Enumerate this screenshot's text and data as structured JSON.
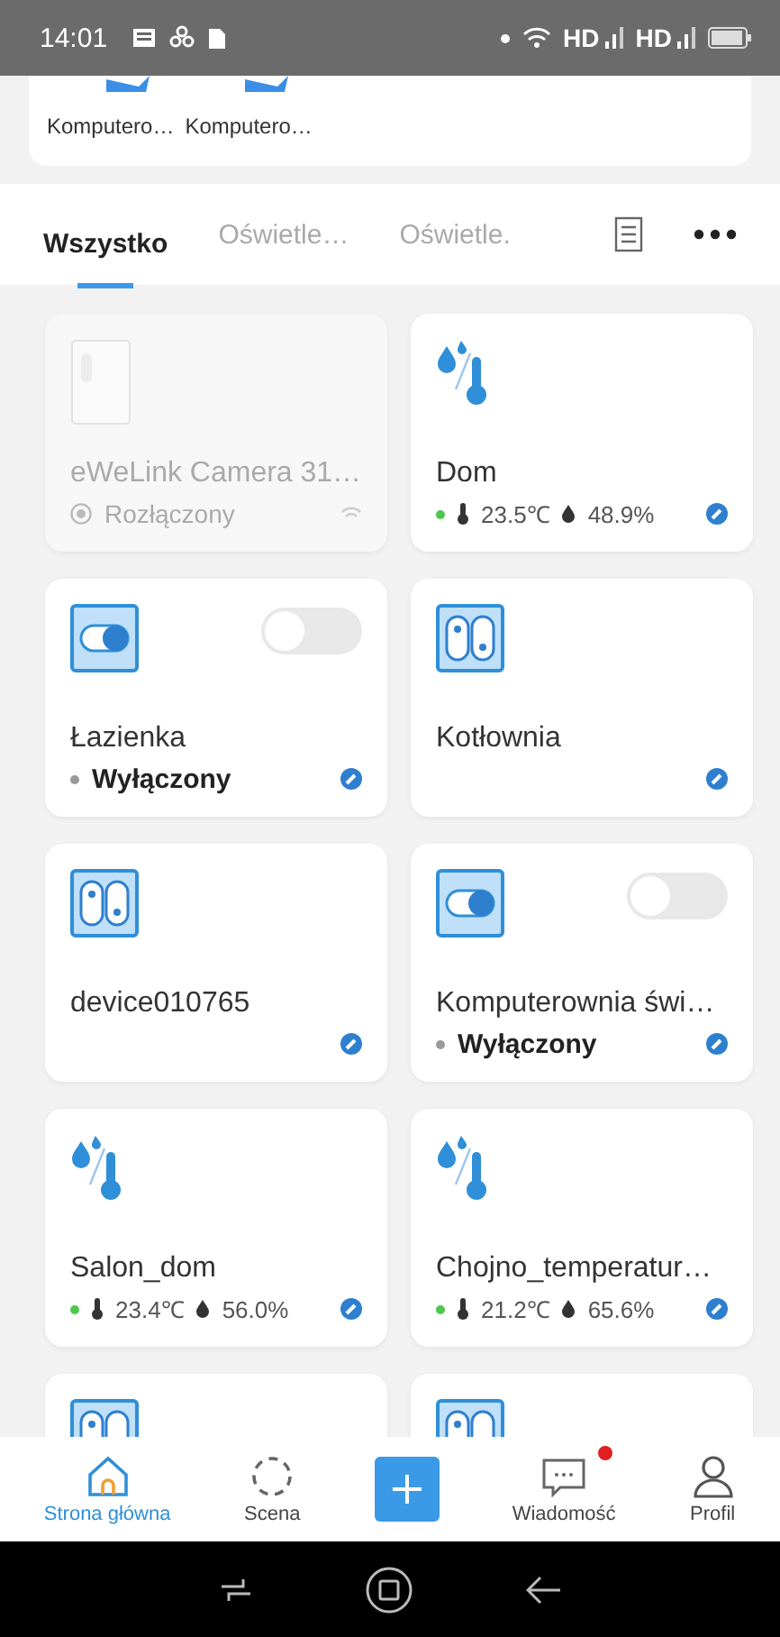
{
  "status_bar": {
    "time": "14:01",
    "network_labels": [
      "HD",
      "HD"
    ]
  },
  "shortcuts": [
    {
      "label": "Komputero…"
    },
    {
      "label": "Komputero…"
    }
  ],
  "tabs": [
    {
      "label": "Wszystko",
      "selected": true
    },
    {
      "label": "Oświetle…",
      "selected": false
    },
    {
      "label": "Oświetle.",
      "selected": false
    }
  ],
  "devices": [
    {
      "kind": "camera",
      "name": "eWeLink Camera 31…",
      "status": "Rozłączony",
      "offline": true
    },
    {
      "kind": "sensor",
      "name": "Dom",
      "temperature": "23.5℃",
      "humidity": "48.9%",
      "offline": false
    },
    {
      "kind": "switch",
      "name": "Łazienka",
      "status": "Wyłączony",
      "on": false,
      "offline": false
    },
    {
      "kind": "dual",
      "name": "Kotłownia",
      "offline": false
    },
    {
      "kind": "dual",
      "name": "device010765",
      "offline": false
    },
    {
      "kind": "switch",
      "name": "Komputerownia świ…",
      "status": "Wyłączony",
      "on": false,
      "offline": false
    },
    {
      "kind": "sensor",
      "name": "Salon_dom",
      "temperature": "23.4℃",
      "humidity": "56.0%",
      "offline": false
    },
    {
      "kind": "sensor",
      "name": "Chojno_temperatur…",
      "temperature": "21.2℃",
      "humidity": "65.6%",
      "offline": false
    },
    {
      "kind": "dual"
    },
    {
      "kind": "dual"
    }
  ],
  "bottom_nav": [
    {
      "kind": "home",
      "label": "Strona główna",
      "selected": true
    },
    {
      "kind": "scene",
      "label": "Scena",
      "selected": false
    },
    {
      "kind": "add"
    },
    {
      "kind": "message",
      "label": "Wiadomość",
      "selected": false,
      "badge": true
    },
    {
      "kind": "profile",
      "label": "Profil",
      "selected": false
    }
  ]
}
